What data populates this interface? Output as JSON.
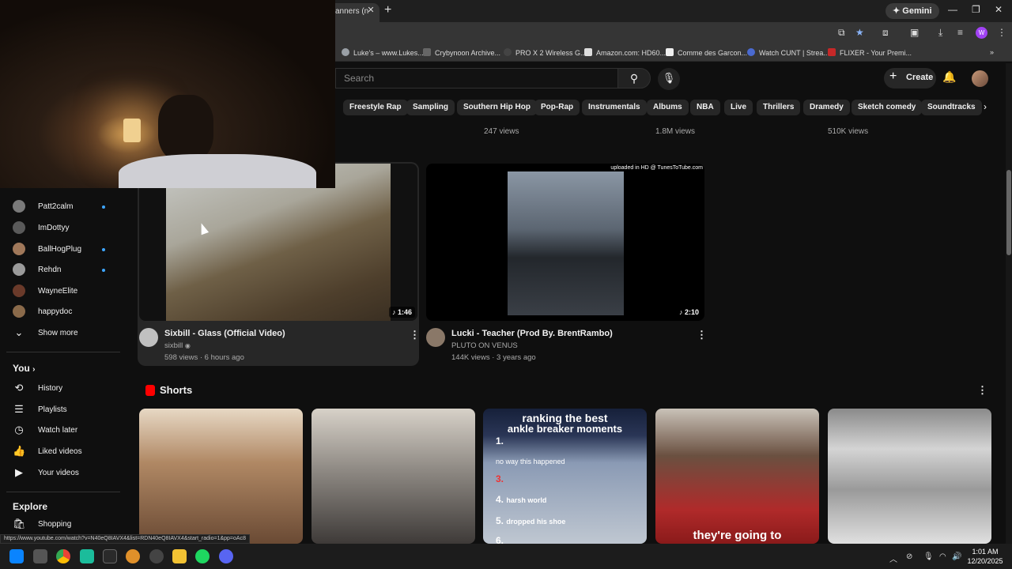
{
  "browser": {
    "tab_title": "anners (n",
    "gemini_label": "Gemini",
    "profile_initial": "W",
    "bookmarks": [
      "Luke's – www.Lukes...",
      "Crybynoon Archive...",
      "PRO X 2 Wireless G...",
      "Amazon.com: HD60...",
      "Comme des Garcon...",
      "Watch CUNT | Strea...",
      "FLIXER - Your Premi..."
    ],
    "status_url": "https://www.youtube.com/watch?v=N40eQ8IAVX4&list=RDN40eQ8IAVX4&start_radio=1&pp=oAc8"
  },
  "yt_header": {
    "search_placeholder": "Search",
    "create_label": "Create"
  },
  "chips": [
    "Freestyle Rap",
    "Sampling",
    "Southern Hip Hop",
    "Pop-Rap",
    "Instrumentals",
    "Albums",
    "NBA",
    "Live",
    "Thrillers",
    "Dramedy",
    "Sketch comedy",
    "Soundtracks"
  ],
  "prev_row_views": [
    "247 views",
    "1.8M views",
    "510K views"
  ],
  "sidebar": {
    "subscriptions": [
      {
        "name": "Patt2calm",
        "dot": true,
        "color": "#7a7a7a"
      },
      {
        "name": "ImDottyy",
        "dot": false,
        "color": "#5a5a5a"
      },
      {
        "name": "BallHogPlug",
        "dot": true,
        "color": "#a0785a"
      },
      {
        "name": "Rehdn",
        "dot": true,
        "color": "#9a9a9a"
      },
      {
        "name": "WayneElite",
        "dot": false,
        "color": "#6a3a2a"
      },
      {
        "name": "happydoc",
        "dot": false,
        "color": "#8a6a4a"
      }
    ],
    "show_more": "Show more",
    "you_heading": "You",
    "you_items": [
      "History",
      "Playlists",
      "Watch later",
      "Liked videos",
      "Your videos"
    ],
    "explore_heading": "Explore",
    "explore_items": [
      "Shopping"
    ]
  },
  "videos": [
    {
      "title": "Sixbill - Glass (Official Video)",
      "channel": "sixbill",
      "verified": true,
      "meta": "598 views · 6 hours ago",
      "duration": "1:46"
    },
    {
      "title": "Lucki - Teacher (Prod By. BrentRambo)",
      "channel": "PLUTO ON VENUS",
      "verified": false,
      "meta": "144K views · 3 years ago",
      "duration": "2:10",
      "overlay_text": "uploaded in HD @ TunesToTube.com"
    }
  ],
  "shorts": {
    "heading": "Shorts",
    "overlay_texts": {
      "s3_title_line1": "ranking the best",
      "s3_title_line2": "ankle breaker moments",
      "s3_item1": "1.",
      "s3_item1_text": "no way this happened",
      "s3_item3": "3.",
      "s3_item4": "4.",
      "s3_item4_text": "harsh world",
      "s3_item5": "5.",
      "s3_item5_text": "dropped his shoe",
      "s3_item6": "6.",
      "s4_caption": "they're going to"
    }
  },
  "taskbar": {
    "time": "1:01 AM",
    "date": "12/20/2025"
  }
}
